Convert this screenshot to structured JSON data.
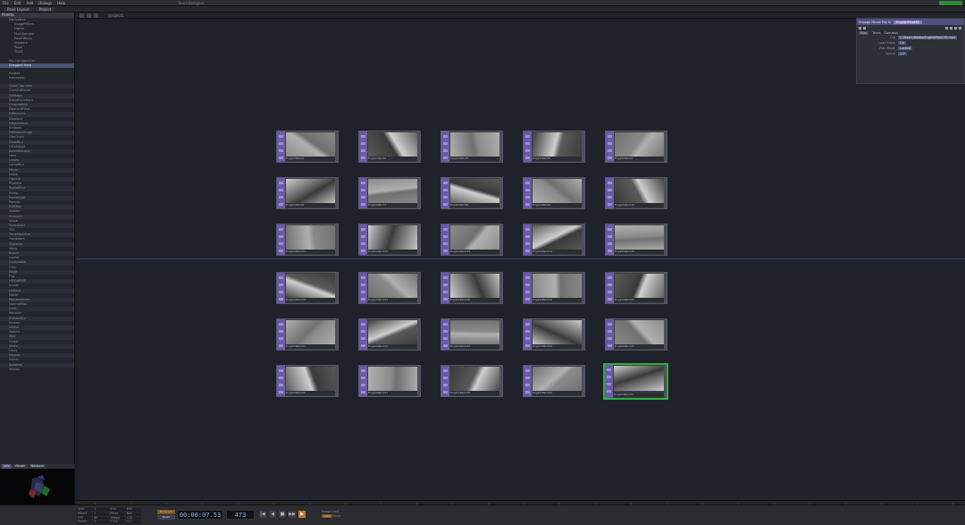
{
  "menubar": {
    "items": [
      "File",
      "Edit",
      "Add",
      "Dialogs",
      "Help"
    ],
    "title": "TouchDesigner",
    "perf_color": "#2f8a3a"
  },
  "tabbar": {
    "tabs": [
      "Pane Layout",
      "Project"
    ]
  },
  "toolbar": {
    "path": "/project1"
  },
  "palette": {
    "header": "Palette",
    "items": [
      "Derivative",
      "ImageFilters",
      "Lights",
      "MultiSample",
      "PostEffects",
      "Shaders",
      "Tools",
      "TDVR",
      "My Components",
      "Dragged Here",
      "Project",
      "Examples",
      "ColorChannels",
      "ContentPanel",
      "DirMaps",
      "BlendFunctions",
      "ChromaKey",
      "DepthOfField",
      "Difference",
      "Displace",
      "EdgeDetect",
      "Emboss",
      "FeedbackEdge",
      "FilmGrain",
      "GlowBlur",
      "HSVAdjust",
      "Kaleidoscope",
      "Lens",
      "Levels",
      "LumaBlur",
      "Mirror",
      "Noise",
      "Optical",
      "Pixelate",
      "RadialBlur",
      "Ramp",
      "Rectangle",
      "Remap",
      "RGBKey",
      "Scatter",
      "Sharpen",
      "Slope",
      "Threshold",
      "Tile",
      "TimeMachine",
      "Transform",
      "Vignette",
      "Warp",
      "Bloom",
      "Cache",
      "Composite",
      "Crop",
      "Edge",
      "Flip",
      "HSVtoRGB",
      "Inside",
      "Lookup",
      "Matte",
      "Monochrome",
      "NormalMap",
      "Over",
      "Reorder",
      "RGBtoHSV",
      "Screen",
      "Select",
      "Switch",
      "Text",
      "Under",
      "Video",
      "Lines",
      "Movies",
      "Points",
      "Spheres",
      "Waves"
    ]
  },
  "viewer": {
    "tabs": [
      "Info",
      "Viewer",
      "Network"
    ]
  },
  "nodes": [
    "EnglishPaint1",
    "EnglishPaint2",
    "EnglishPaint3",
    "EnglishPaint4",
    "EnglishPaint5",
    "EnglishPaint6",
    "EnglishPaint7",
    "EnglishPaint8",
    "EnglishPaint9",
    "EnglishPaint10",
    "EnglishPaint11",
    "EnglishPaint12",
    "EnglishPaint13",
    "EnglishPaint14",
    "EnglishPaint15",
    "EnglishPaint16",
    "EnglishPaint17",
    "EnglishPaint18",
    "EnglishPaint19",
    "EnglishPaint20",
    "EnglishPaint21",
    "EnglishPaint22",
    "EnglishPaint23",
    "EnglishPaint24",
    "EnglishPaint25",
    "EnglishPaint26",
    "EnglishPaint27",
    "EnglishPaint28",
    "EnglishPaint29",
    "EnglishPaint30"
  ],
  "selected_node": 29,
  "params": {
    "op_type": "Engage Movie File In",
    "op_name": "EnglishPaint30",
    "tabs": [
      "Play",
      "Trims",
      "Common"
    ],
    "file_label": "File",
    "file_value": "C:/Users/Media/EnglishPaint30.mov",
    "reload_label": "Load Fresh",
    "reload_value": "On",
    "playmode_label": "Play Mode",
    "playmode_value": "Locked",
    "speed_label": "Speed",
    "speed_value": "1.0"
  },
  "timebar": {
    "grid": [
      "Start",
      "1",
      "End",
      "600",
      "RStart",
      "1",
      "REnd",
      "600",
      "FPS",
      "60",
      "Tempo",
      "120",
      "Resetf",
      "1",
      "T Sig",
      "4 4"
    ],
    "time_button": "Timecode",
    "beats_button": "Beats",
    "timecode": "00:00:07.53",
    "frame": "473",
    "transport": [
      "|◀",
      "◀",
      "■",
      "▶▶",
      "▶"
    ],
    "range_label": "Range Limit",
    "range_on": "Loop",
    "range_off": "Once"
  },
  "colors": {
    "canvas_bg": "#1f222b",
    "node_strip": "#6a5aa8",
    "selected_border": "#2fae3c",
    "play_accent": "#c8741a"
  }
}
